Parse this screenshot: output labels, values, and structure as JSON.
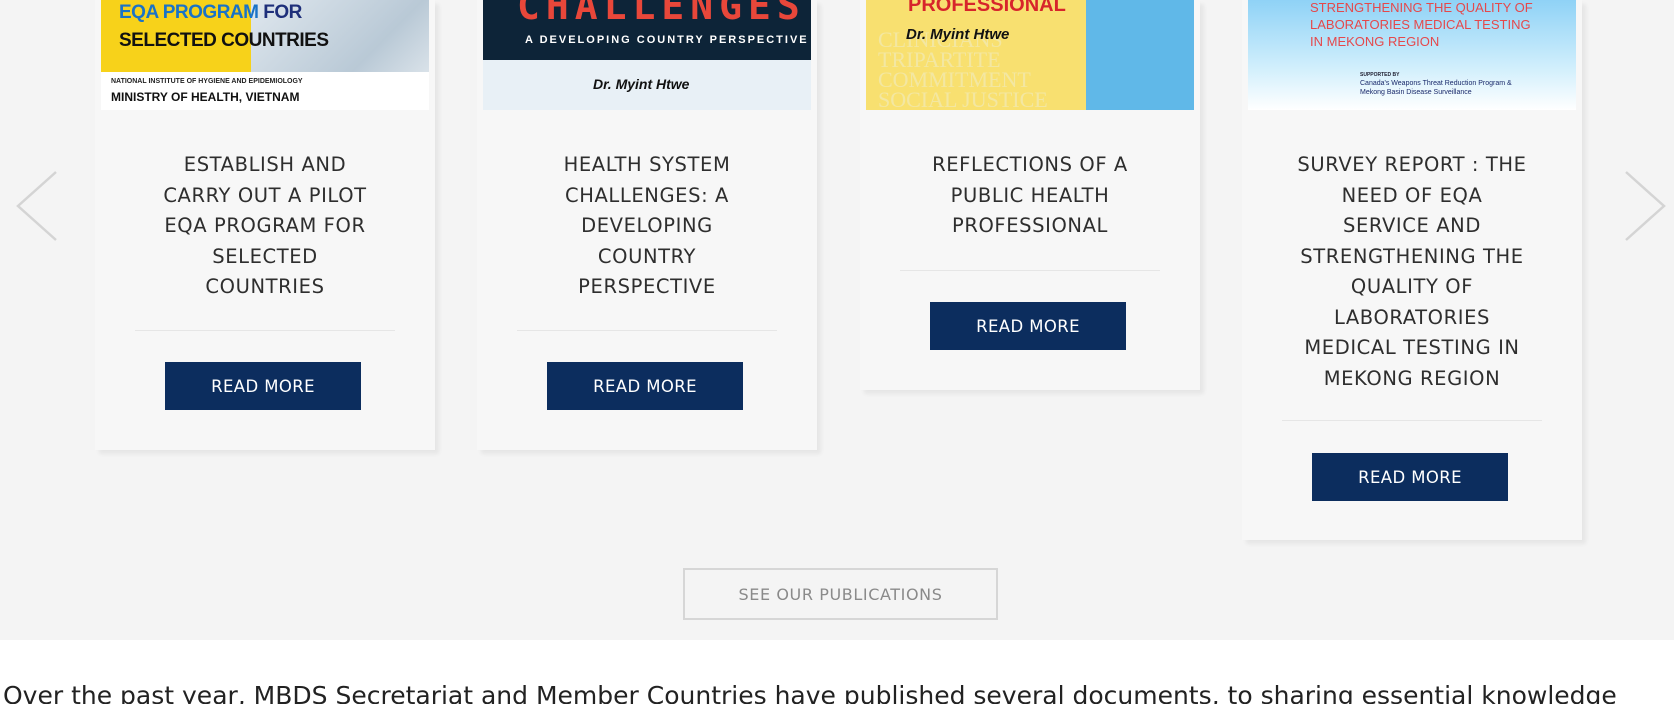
{
  "publications": [
    {
      "title": "ESTABLISH AND CARRY OUT A PILOT EQA PROGRAM FOR SELECTED COUNTRIES",
      "title_lines": [
        "ESTABLISH AND",
        "CARRY OUT A PILOT",
        "EQA PROGRAM FOR",
        "SELECTED",
        "COUNTRIES"
      ],
      "button": "READ MORE",
      "cover": {
        "line1_a": "EQA PROGRAM",
        "line1_b": "FOR",
        "line2": "SELECTED COUNTRIES",
        "institute": "NATIONAL INSTITUTE OF HYGIENE AND EPIDEMIOLOGY",
        "ministry": "MINISTRY OF HEALTH, VIETNAM"
      }
    },
    {
      "title": "HEALTH SYSTEM CHALLENGES: A DEVELOPING COUNTRY PERSPECTIVE",
      "title_lines": [
        "HEALTH SYSTEM",
        "CHALLENGES: A",
        "DEVELOPING",
        "COUNTRY",
        "PERSPECTIVE"
      ],
      "button": "READ MORE",
      "cover": {
        "heading": "CHALLENGES",
        "subheading": "A DEVELOPING COUNTRY PERSPECTIVE",
        "author": "Dr. Myint Htwe"
      }
    },
    {
      "title": "REFLECTIONS OF A PUBLIC HEALTH PROFESSIONAL",
      "title_lines": [
        "REFLECTIONS OF A",
        "PUBLIC HEALTH",
        "PROFESSIONAL"
      ],
      "button": "READ MORE",
      "cover": {
        "heading": "PROFESSIONAL",
        "author": "Dr. Myint Htwe",
        "background_words": "CLINICIANS TRIPARTITE COMMITMENT SOCIAL JUSTICE"
      }
    },
    {
      "title": "SURVEY REPORT : THE NEED OF EQA SERVICE AND STRENGTHENING THE QUALITY OF LABORATORIES MEDICAL TESTING IN MEKONG REGION",
      "title_lines": [
        "SURVEY REPORT : THE",
        "NEED OF EQA",
        "SERVICE AND",
        "STRENGTHENING THE",
        "QUALITY OF",
        "LABORATORIES",
        "MEDICAL TESTING IN",
        "MEKONG REGION"
      ],
      "button": "READ MORE",
      "cover": {
        "line1": "STRENGTHENING THE QUALITY OF",
        "line2": "LABORATORIES MEDICAL TESTING",
        "line3": "IN MEKONG REGION",
        "supported_by": "SUPPORTED BY",
        "sponsor_1": "Canada's Weapons Threat Reduction Program &",
        "sponsor_2": "Mekong Basin Disease Surveillance"
      }
    }
  ],
  "carousel": {
    "prev_icon": "chevron-left-icon",
    "next_icon": "chevron-right-icon"
  },
  "see_publications": "SEE OUR PUBLICATIONS",
  "bottom_text": "Over the past year, MBDS Secretariat and Member Countries have published several documents, to sharing essential knowledge",
  "colors": {
    "button": "#0c2d5e",
    "section_bg": "#f4f4f4"
  }
}
